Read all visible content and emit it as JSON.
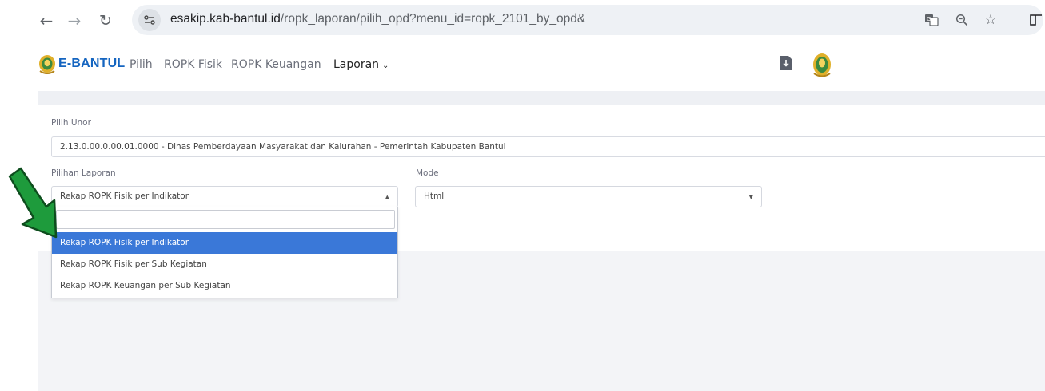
{
  "browser": {
    "url_host": "esakip.kab-bantul.id",
    "url_path": "/ropk_laporan/pilih_opd?menu_id=ropk_2101_by_opd&"
  },
  "navbar": {
    "brand": "E-BANTUL",
    "items": [
      {
        "label": "Pilih"
      },
      {
        "label": "ROPK Fisik"
      },
      {
        "label": "ROPK Keuangan"
      },
      {
        "label": "Laporan"
      }
    ]
  },
  "form": {
    "unor_label": "Pilih Unor",
    "unor_value": "2.13.0.00.0.00.01.0000 - Dinas Pemberdayaan Masyarakat dan Kalurahan - Pemerintah Kabupaten Bantul",
    "laporan_label": "Pilihan Laporan",
    "laporan_value": "Rekap ROPK Fisik per Indikator",
    "mode_label": "Mode",
    "mode_value": "Html",
    "dropdown": {
      "search_value": "",
      "options": [
        {
          "label": "Rekap ROPK Fisik per Indikator",
          "active": true
        },
        {
          "label": "Rekap ROPK Fisik per Sub Kegiatan",
          "active": false
        },
        {
          "label": "Rekap ROPK Keuangan per Sub Kegiatan",
          "active": false
        }
      ]
    }
  },
  "colors": {
    "brand": "#1565c0",
    "active_option": "#3a78d8",
    "annotation_arrow": "#1e9b3c"
  },
  "icons": [
    "back-arrow-icon",
    "forward-arrow-icon",
    "reload-icon",
    "site-settings-icon",
    "translate-icon",
    "zoom-icon",
    "star-icon",
    "extension-icon",
    "logo-emblem-icon",
    "download-icon",
    "avatar-emblem-icon",
    "caret-icon"
  ]
}
